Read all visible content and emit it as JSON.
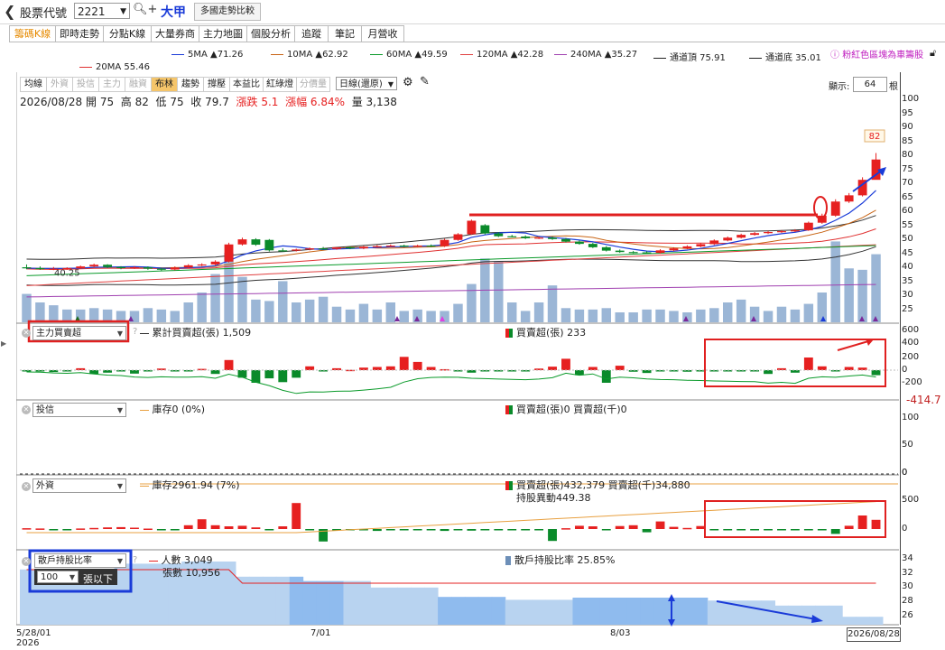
{
  "app": {
    "back_icon": "chevron-left-icon",
    "code_label": "股票代號",
    "code_value": "2221",
    "stock_name": "大甲",
    "compare_button": "多國走勢比較"
  },
  "tabs": [
    {
      "label": "籌碼K線",
      "active": true
    },
    {
      "label": "即時走勢",
      "active": false
    },
    {
      "label": "分點K線",
      "active": false
    },
    {
      "label": "大量券商",
      "active": false
    },
    {
      "label": "主力地圖",
      "active": false
    },
    {
      "label": "個股分析",
      "active": false
    },
    {
      "label": "追蹤",
      "active": false
    },
    {
      "label": "筆記",
      "active": false
    },
    {
      "label": "月營收",
      "active": false
    }
  ],
  "ma_legend": [
    {
      "label": "5MA ▲71.26",
      "color": "#1a3bd8"
    },
    {
      "label": "10MA ▲62.92",
      "color": "#c86414"
    },
    {
      "label": "60MA ▲49.59",
      "color": "#0a9a2a"
    },
    {
      "label": "120MA ▲42.28",
      "color": "#e04040"
    },
    {
      "label": "240MA ▲35.27",
      "color": "#a040b0"
    },
    {
      "label": "通道頂 75.91",
      "color": "#222222"
    },
    {
      "label": "通道底 35.01",
      "color": "#222222"
    },
    {
      "label": "20MA 55.46",
      "color": "#e03030"
    }
  ],
  "hint_text": "粉紅色區塊為車籌股",
  "toolbar": {
    "buttons": [
      {
        "label": "均線",
        "state": "normal"
      },
      {
        "label": "外資",
        "state": "disabled"
      },
      {
        "label": "投信",
        "state": "disabled"
      },
      {
        "label": "主力",
        "state": "disabled"
      },
      {
        "label": "融資",
        "state": "disabled"
      },
      {
        "label": "布林",
        "state": "on"
      },
      {
        "label": "趨勢",
        "state": "normal"
      },
      {
        "label": "撐壓",
        "state": "normal"
      },
      {
        "label": "本益比",
        "state": "normal"
      },
      {
        "label": "紅綠燈",
        "state": "normal"
      },
      {
        "label": "分價量",
        "state": "disabled"
      }
    ],
    "period_select": "日線(還原)",
    "display_label": "顯示:",
    "display_value": "64",
    "display_unit": "根"
  },
  "info": {
    "date": "2026/08/28",
    "open_label": "開",
    "open": "75",
    "high_label": "高",
    "high": "82",
    "low_label": "低",
    "low": "75",
    "close_label": "收",
    "close": "79.7",
    "change_label": "漲跌",
    "change": "5.1",
    "pct_label": "漲幅",
    "pct": "6.84%",
    "vol_label": "量",
    "vol": "3,138"
  },
  "panels": {
    "main_force": {
      "select": "主力買賣超",
      "cum_legend": "累計買賣超(張) 1,509",
      "bar_legend": "買賣超(張) 233",
      "neg_label": "-414.7"
    },
    "trust": {
      "select": "投信",
      "inv_legend": "庫存0 (0%)",
      "bar_legend": "買賣超(張)0 買賣超(千)0"
    },
    "foreign": {
      "select": "外資",
      "inv_legend": "庫存2961.94 (7%)",
      "bar_legend": "買賣超(張)432,379 買賣超(千)34,880",
      "hold_change": "持股異動449.38"
    },
    "holder": {
      "select": "散戶持股比率",
      "sub_select": "100",
      "sub_unit": "張以下",
      "people_legend": "人數 3,049",
      "shares_legend": "張數 10,956",
      "ratio_legend": "散戶持股比率 25.85%"
    }
  },
  "x_axis": {
    "labels": [
      "5/28/01",
      "7/01",
      "8/03"
    ],
    "year": "2026",
    "current_date": "2026/08/28"
  },
  "y_axes": {
    "price": [
      "100",
      "95",
      "90",
      "85",
      "80",
      "75",
      "70",
      "65",
      "60",
      "55",
      "50",
      "45",
      "40",
      "35",
      "30",
      "25"
    ],
    "main_force": [
      "600",
      "400",
      "200",
      "0",
      "-200"
    ],
    "trust": [
      "100",
      "50",
      "0"
    ],
    "foreign": [
      "0",
      "500",
      "0"
    ],
    "holder": [
      "34",
      "32",
      "30",
      "28",
      "26"
    ]
  },
  "chart_data": {
    "type": "candlestick",
    "title": "大甲 2221 日線(還原)",
    "candles": {
      "open": [
        41.5,
        41.2,
        41.0,
        41.0,
        41.2,
        41.8,
        42.4,
        41.6,
        41.2,
        41.5,
        41.0,
        40.7,
        41.4,
        42.2,
        42.5,
        43.5,
        49.6,
        51.4,
        51.2,
        47.5,
        47.4,
        47.8,
        48.2,
        48.0,
        48.6,
        48.2,
        48.8,
        49.0,
        49.2,
        48.9,
        49.2,
        49.0,
        51.2,
        53.2,
        56.4,
        53.5,
        52.5,
        52.4,
        51.8,
        52.0,
        51.5,
        50.6,
        49.8,
        48.6,
        47.4,
        46.9,
        46.8,
        46.6,
        47.5,
        48.2,
        48.9,
        49.7,
        51.0,
        52.0,
        53.0,
        53.6,
        54.0,
        54.3,
        54.6,
        57.3,
        59.8,
        64.8,
        67.0,
        72.5
      ],
      "close": [
        41.2,
        41.0,
        41.0,
        41.2,
        41.8,
        42.4,
        41.6,
        41.2,
        41.5,
        41.0,
        40.7,
        41.4,
        42.2,
        42.5,
        43.5,
        49.6,
        51.4,
        49.5,
        47.5,
        47.4,
        47.8,
        48.2,
        48.0,
        48.6,
        48.2,
        48.8,
        49.0,
        49.2,
        48.9,
        49.2,
        49.0,
        51.2,
        53.2,
        58.0,
        53.5,
        52.5,
        52.4,
        51.8,
        52.0,
        51.5,
        50.6,
        49.8,
        48.6,
        47.4,
        46.9,
        46.8,
        46.6,
        47.5,
        48.2,
        48.9,
        49.7,
        51.0,
        52.0,
        53.0,
        53.6,
        54.0,
        54.3,
        54.6,
        57.3,
        59.8,
        64.8,
        67.0,
        72.5,
        79.7
      ],
      "high": [
        42.5,
        41.8,
        41.6,
        41.5,
        42.1,
        42.8,
        42.6,
        41.9,
        41.9,
        41.8,
        41.3,
        41.8,
        42.6,
        42.9,
        44.0,
        50.2,
        52.0,
        51.8,
        51.5,
        48.2,
        48.1,
        48.5,
        48.7,
        48.5,
        49.0,
        49.1,
        49.4,
        49.6,
        49.5,
        49.5,
        49.6,
        51.6,
        53.6,
        58.4,
        56.8,
        54.0,
        53.0,
        52.8,
        52.4,
        52.4,
        51.9,
        51.0,
        50.2,
        49.0,
        47.8,
        47.3,
        47.2,
        47.9,
        48.6,
        49.3,
        50.1,
        51.4,
        52.4,
        53.4,
        54.0,
        54.4,
        54.7,
        55.0,
        57.7,
        60.5,
        65.6,
        67.8,
        73.4,
        82.0
      ],
      "low": [
        40.8,
        40.6,
        40.5,
        40.6,
        40.9,
        41.4,
        41.2,
        40.8,
        40.9,
        40.6,
        40.2,
        40.4,
        41.1,
        41.9,
        42.2,
        43.2,
        49.2,
        49.1,
        47.1,
        47.0,
        47.1,
        47.5,
        47.7,
        47.7,
        47.9,
        47.9,
        48.5,
        48.7,
        48.6,
        48.6,
        48.7,
        48.7,
        50.9,
        53.0,
        53.1,
        52.2,
        52.1,
        51.5,
        51.5,
        51.2,
        50.3,
        49.5,
        48.3,
        47.1,
        46.6,
        46.4,
        46.3,
        46.3,
        47.2,
        47.9,
        48.6,
        49.4,
        50.7,
        51.7,
        52.7,
        53.3,
        53.7,
        54.0,
        54.4,
        56.9,
        59.4,
        64.3,
        66.6,
        75.0
      ]
    },
    "volume": [
      20,
      14,
      12,
      9,
      9,
      10,
      9,
      8,
      8,
      10,
      9,
      8,
      14,
      21,
      34,
      49,
      32,
      16,
      15,
      29,
      14,
      16,
      18,
      11,
      9,
      13,
      9,
      14,
      8,
      9,
      8,
      8,
      13,
      27,
      45,
      43,
      14,
      8,
      14,
      26,
      10,
      9,
      9,
      10,
      7,
      7,
      9,
      9,
      8,
      7,
      9,
      10,
      14,
      16,
      11,
      8,
      11,
      9,
      13,
      21,
      57,
      38,
      37,
      48
    ],
    "main_force": [
      -20,
      -10,
      -30,
      -15,
      30,
      -60,
      -40,
      -20,
      -55,
      -20,
      25,
      -10,
      -5,
      20,
      -60,
      160,
      -120,
      -200,
      -130,
      -190,
      -120,
      60,
      -5,
      30,
      5,
      40,
      50,
      60,
      210,
      130,
      50,
      15,
      -8,
      -40,
      -12,
      -20,
      -10,
      -15,
      25,
      55,
      180,
      -80,
      50,
      -200,
      70,
      -25,
      -45,
      -20,
      -10,
      -25,
      -5,
      -20,
      -5,
      -15,
      -3,
      -60,
      30,
      -40,
      200,
      60,
      -20,
      50,
      40,
      -80
    ],
    "main_force_cum": [
      -70,
      -80,
      -110,
      -125,
      -95,
      -155,
      -195,
      -215,
      -270,
      -290,
      -265,
      -275,
      -280,
      -260,
      -320,
      -160,
      -280,
      -480,
      -610,
      -800,
      -920,
      -860,
      -865,
      -835,
      -830,
      -790,
      -740,
      -680,
      -470,
      -340,
      -290,
      -275,
      -283,
      -323,
      -335,
      -355,
      -365,
      -380,
      -355,
      -300,
      -120,
      -200,
      -150,
      -350,
      -280,
      -305,
      -350,
      -370,
      -380,
      -405,
      -410,
      -430,
      -435,
      -450,
      -453,
      -513,
      -483,
      -523,
      -323,
      -263,
      -283,
      -233,
      -193,
      -273
    ],
    "foreign": [
      15,
      10,
      -5,
      -12,
      10,
      20,
      30,
      35,
      25,
      8,
      -5,
      -10,
      70,
      180,
      70,
      50,
      60,
      30,
      -25,
      50,
      480,
      -5,
      -230,
      -25,
      -25,
      -25,
      -35,
      -10,
      -10,
      -20,
      -20,
      -35,
      -10,
      -30,
      -20,
      -5,
      -20,
      -10,
      -10,
      -220,
      15,
      60,
      50,
      -10,
      55,
      70,
      -60,
      140,
      40,
      20,
      55,
      -25,
      -10,
      -20,
      -10,
      -5,
      -10,
      -5,
      -10,
      -5,
      -90,
      60,
      250,
      170
    ],
    "holder_ratio": [
      32.4,
      32.4,
      32.4,
      32.4,
      32.4,
      32.4,
      32.4,
      33.2,
      33.2,
      33.2,
      33.2,
      33.2,
      33.5,
      33.5,
      33.5,
      33.5,
      31.4,
      31.4,
      31.4,
      31.4,
      31.4,
      30.8,
      30.8,
      30.8,
      30.8,
      30.8,
      29.9,
      29.9,
      29.9,
      29.9,
      29.9,
      28.6,
      28.6,
      28.6,
      28.6,
      28.6,
      28.2,
      28.2,
      28.2,
      28.2,
      28.2,
      28.5,
      28.5,
      28.5,
      28.5,
      28.5,
      28.5,
      28.5,
      28.5,
      28.5,
      28.5,
      28.1,
      28.1,
      28.1,
      28.1,
      28.1,
      27.4,
      27.4,
      27.4,
      27.4,
      27.4,
      25.85,
      25.85,
      25.85
    ],
    "price_ylim": [
      22,
      102
    ]
  }
}
